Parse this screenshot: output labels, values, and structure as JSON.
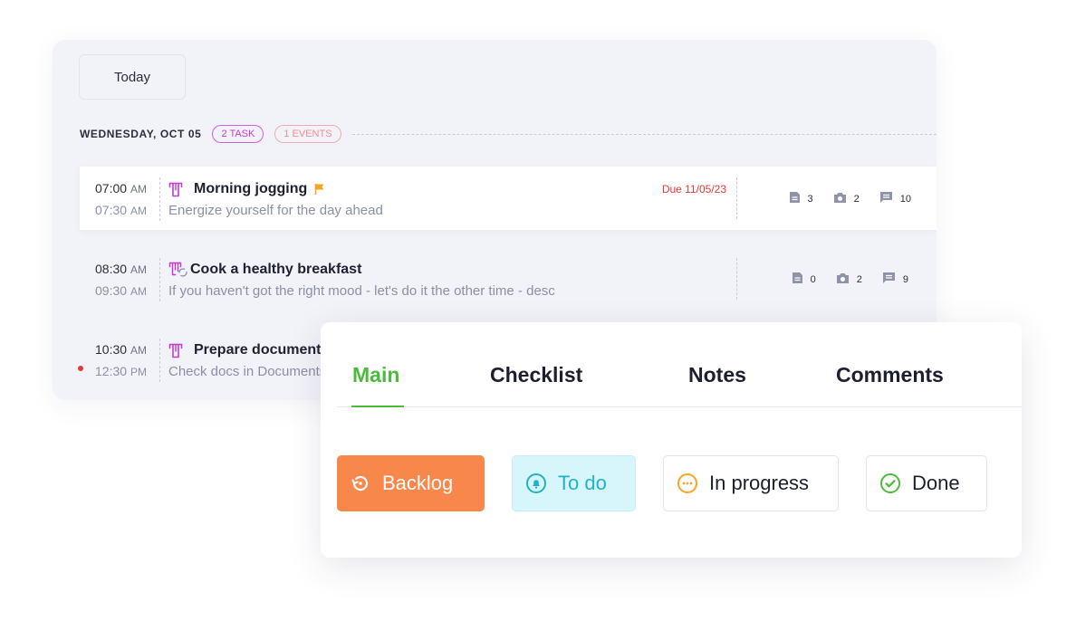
{
  "calendar": {
    "today_label": "Today",
    "date_label": "WEDNESDAY, OCT 05",
    "task_count": "2 TASK",
    "event_count": "1 EVENTS",
    "tasks": [
      {
        "start_time": "07:00",
        "start_ampm": "AM",
        "end_time": "07:30",
        "end_ampm": "AM",
        "title": "Morning jogging",
        "description": "Energize yourself for the day ahead",
        "due": "Due 11/05/23",
        "flag_color": "#f5a623",
        "notes": "3",
        "photos": "2",
        "comments": "10"
      },
      {
        "start_time": "08:30",
        "start_ampm": "AM",
        "end_time": "09:30",
        "end_ampm": "AM",
        "title": "Cook a healthy breakfast",
        "description": "If you haven't got the right mood - let's do it the other time - desc",
        "notes": "0",
        "photos": "2",
        "comments": "9"
      },
      {
        "start_time": "10:30",
        "start_ampm": "AM",
        "end_time": "12:30",
        "end_ampm": "PM",
        "title": "Prepare documents",
        "description": "Check docs in Documents"
      }
    ]
  },
  "panel": {
    "tabs": [
      "Main",
      "Checklist",
      "Notes",
      "Comments"
    ],
    "statuses": {
      "backlog": "Backlog",
      "todo": "To do",
      "in_progress": "In progress",
      "done": "Done"
    }
  },
  "colors": {
    "accent_green": "#4cbb3c",
    "backlog": "#f7874a",
    "todo": "#22b2c8",
    "in_progress_icon": "#f5a623",
    "done_icon": "#4cbb3c",
    "task_icon": "#c53ad3",
    "due_red": "#e53935"
  }
}
